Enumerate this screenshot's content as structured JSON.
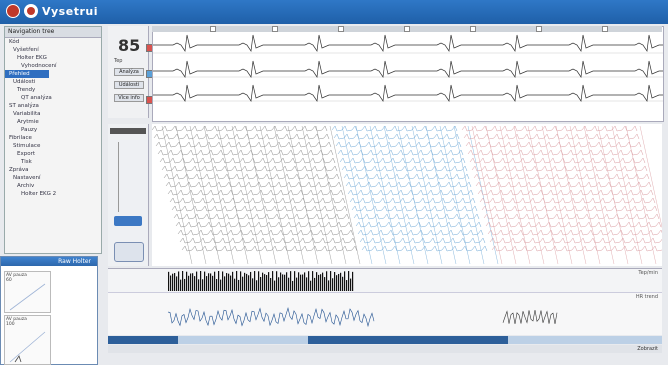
{
  "titlebar": {
    "title": "Vysetrui"
  },
  "tree": {
    "header": "Navigation tree",
    "rows": [
      "Kód",
      "Vyšetření",
      "Holter EKG",
      "Vyhodnocení",
      "Přehled",
      "Události",
      "Trendy",
      "QT analýza",
      "ST analýza",
      "Variabilita",
      "Arytmie",
      "Pauzy",
      "Fibrilace",
      "Stimulace",
      "Export",
      "Tisk",
      "Zpráva",
      "Nastavení",
      "Archiv",
      "Holter EKG 2"
    ],
    "selected": "Přehled"
  },
  "raw_holter": {
    "title": "Raw Holter",
    "cells": [
      {
        "label": "AV pauza\n60"
      },
      {
        "label": "AV pauza\n100"
      }
    ]
  },
  "left_panel": {
    "heart_rate": "85",
    "hr_caption": "Tep",
    "buttons": [
      "Analýza",
      "Události",
      "Více info"
    ]
  },
  "histogram": {
    "label": "Tep/min"
  },
  "trend": {
    "label": "HR trend"
  },
  "status": {
    "right_text": "Zobrazit"
  }
}
